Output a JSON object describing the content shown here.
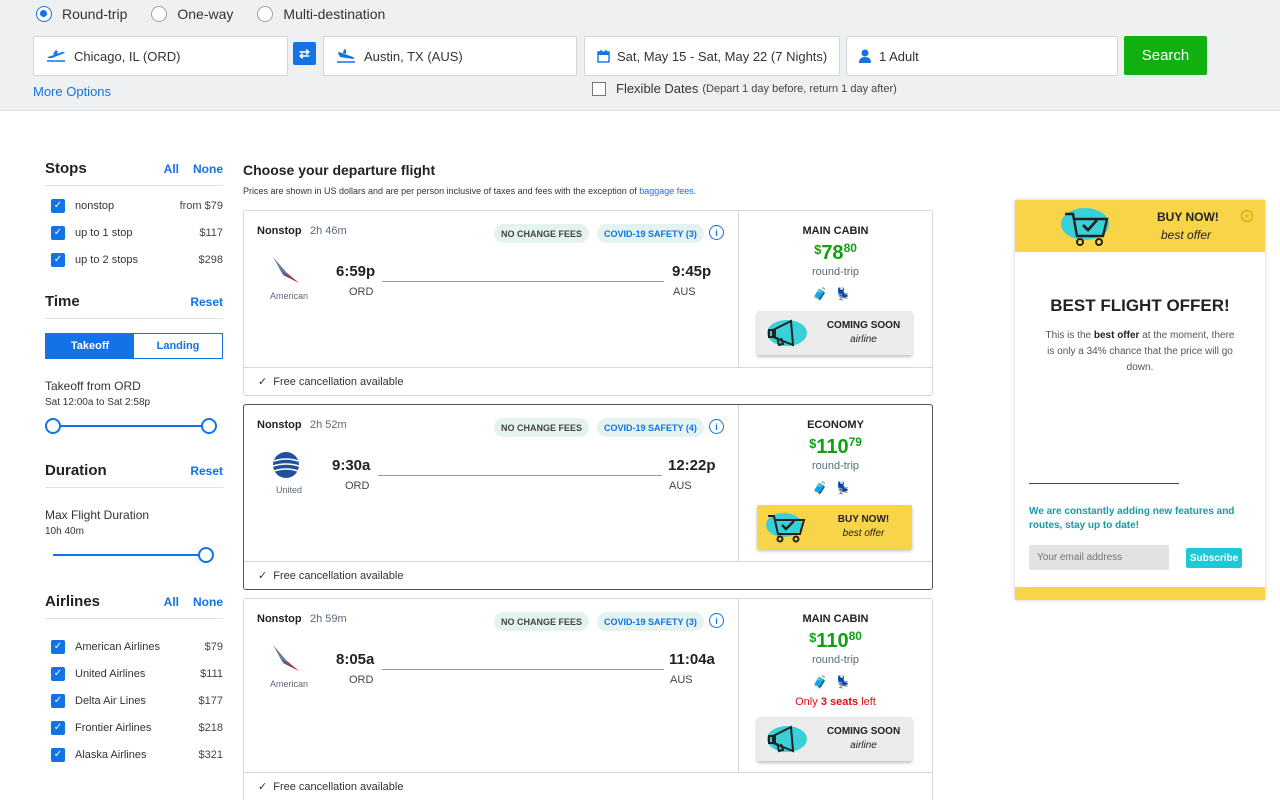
{
  "trip_types": [
    {
      "label": "Round-trip",
      "selected": true
    },
    {
      "label": "One-way",
      "selected": false
    },
    {
      "label": "Multi-destination",
      "selected": false
    }
  ],
  "search": {
    "origin": "Chicago, IL (ORD)",
    "destination": "Austin, TX (AUS)",
    "dates": "Sat, May 15 - Sat, May 22 (7 Nights)",
    "travelers": "1 Adult",
    "button": "Search",
    "more_options": "More Options",
    "flexible_label": "Flexible Dates",
    "flexible_note": "(Depart 1 day before, return 1 day after)"
  },
  "filters": {
    "stops": {
      "title": "Stops",
      "all": "All",
      "none": "None",
      "items": [
        {
          "label": "nonstop",
          "price": "from $79"
        },
        {
          "label": "up to 1 stop",
          "price": "$117"
        },
        {
          "label": "up to 2 stops",
          "price": "$298"
        }
      ]
    },
    "time": {
      "title": "Time",
      "reset": "Reset",
      "tab_takeoff": "Takeoff",
      "tab_landing": "Landing",
      "range_title": "Takeoff from ORD",
      "range_value": "Sat 12:00a to Sat 2:58p"
    },
    "duration": {
      "title": "Duration",
      "reset": "Reset",
      "label": "Max Flight Duration",
      "value": "10h 40m"
    },
    "airlines": {
      "title": "Airlines",
      "all": "All",
      "none": "None",
      "items": [
        {
          "label": "American Airlines",
          "price": "$79"
        },
        {
          "label": "United Airlines",
          "price": "$111"
        },
        {
          "label": "Delta Air Lines",
          "price": "$177"
        },
        {
          "label": "Frontier Airlines",
          "price": "$218"
        },
        {
          "label": "Alaska Airlines",
          "price": "$321"
        }
      ]
    }
  },
  "results": {
    "title": "Choose your departure flight",
    "note": "Prices are shown in US dollars and are per person inclusive of taxes and fees with the exception of",
    "note_link": "baggage fees.",
    "badge_fees": "NO CHANGE FEES",
    "free_cancel": "Free cancellation available",
    "flights": [
      {
        "stops": "Nonstop",
        "duration": "2h 46m",
        "covid": "COVID-19 SAFETY (3)",
        "airline": "American",
        "dep_time": "6:59p",
        "dep_code": "ORD",
        "arr_time": "9:45p",
        "arr_code": "AUS",
        "cabin": "MAIN CABIN",
        "price_whole": "78",
        "price_cents": "80",
        "trip": "round-trip",
        "seats_left": "",
        "promo_title": "COMING SOON",
        "promo_sub": "airline"
      },
      {
        "stops": "Nonstop",
        "duration": "2h 52m",
        "covid": "COVID-19 SAFETY (4)",
        "airline": "United",
        "dep_time": "9:30a",
        "dep_code": "ORD",
        "arr_time": "12:22p",
        "arr_code": "AUS",
        "cabin": "ECONOMY",
        "price_whole": "110",
        "price_cents": "79",
        "trip": "round-trip",
        "seats_left": "",
        "promo_title": "BUY NOW!",
        "promo_sub": "best offer"
      },
      {
        "stops": "Nonstop",
        "duration": "2h 59m",
        "covid": "COVID-19 SAFETY (3)",
        "airline": "American",
        "dep_time": "8:05a",
        "dep_code": "ORD",
        "arr_time": "11:04a",
        "arr_code": "AUS",
        "cabin": "MAIN CABIN",
        "price_whole": "110",
        "price_cents": "80",
        "trip": "round-trip",
        "seats_prefix": "Only",
        "seats_count": "3 seats",
        "seats_suffix": "left",
        "promo_title": "COMING SOON",
        "promo_sub": "airline"
      }
    ]
  },
  "offer": {
    "top_title": "BUY NOW!",
    "top_sub": "best offer",
    "heading": "BEST FLIGHT OFFER!",
    "desc_1": "This is the",
    "desc_bold": "best offer",
    "desc_2": "at the moment, there is only a 34% chance that the price will go down.",
    "news": "We are constantly adding new features and routes, stay up to date!",
    "email_placeholder": "Your email address",
    "subscribe": "Subscribe"
  },
  "colors": {
    "accent": "#1273e6",
    "price": "#11a011",
    "search": "#11b011",
    "offer_yellow": "#f8d449",
    "teal": "#1fc8d8"
  }
}
